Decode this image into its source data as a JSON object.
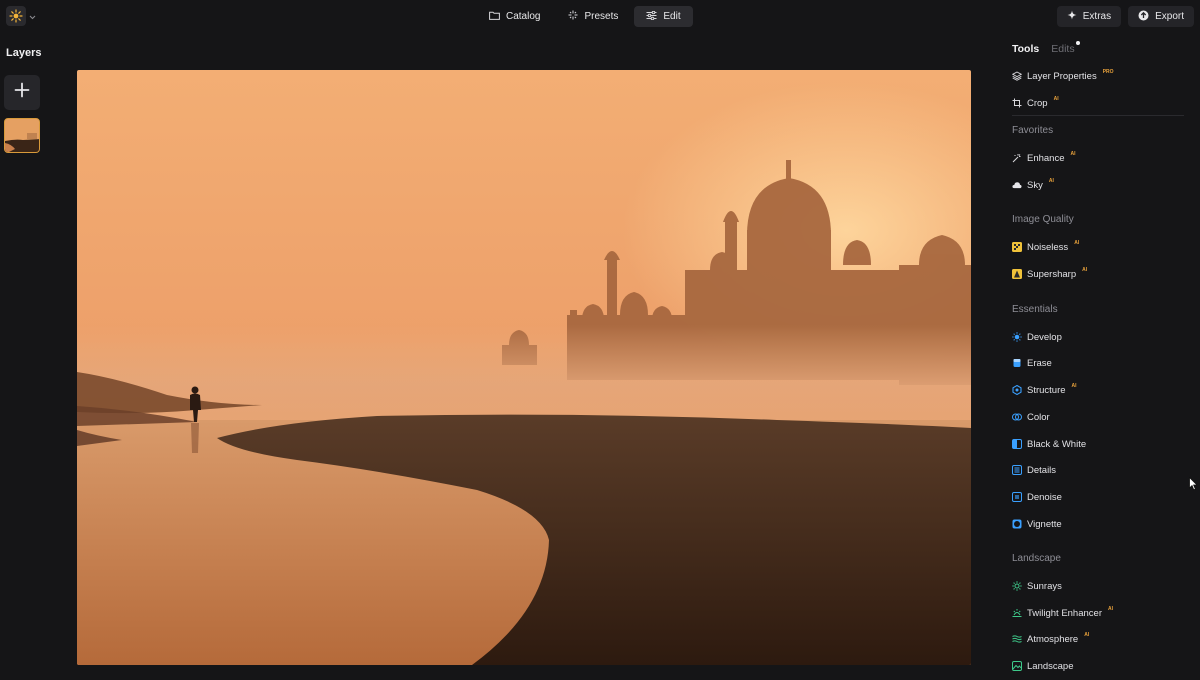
{
  "topbar": {
    "logo_icon": "sun-logo-icon",
    "tabs": [
      {
        "label": "Catalog",
        "icon": "folder-icon"
      },
      {
        "label": "Presets",
        "icon": "sparkle-icon"
      },
      {
        "label": "Edit",
        "icon": "sliders-icon",
        "active": true
      }
    ],
    "extras_label": "Extras",
    "export_label": "Export"
  },
  "layers": {
    "title": "Layers",
    "add_icon": "plus-icon"
  },
  "panel": {
    "tab_tools": "Tools",
    "tab_edits": "Edits",
    "top_tools": [
      {
        "label": "Layer Properties",
        "tag": "PRO",
        "icon": "layers-icon"
      },
      {
        "label": "Crop",
        "tag": "AI",
        "icon": "crop-icon"
      }
    ],
    "sections": [
      {
        "title": "Favorites",
        "tools": [
          {
            "label": "Enhance",
            "tag": "AI",
            "icon": "enhance-icon"
          },
          {
            "label": "Sky",
            "tag": "AI",
            "icon": "cloud-icon"
          }
        ]
      },
      {
        "title": "Image Quality",
        "tools": [
          {
            "label": "Noiseless",
            "tag": "AI",
            "icon": "noiseless-icon"
          },
          {
            "label": "Supersharp",
            "tag": "AI",
            "icon": "supersharp-icon"
          }
        ]
      },
      {
        "title": "Essentials",
        "tools": [
          {
            "label": "Develop",
            "tag": "",
            "icon": "develop-icon"
          },
          {
            "label": "Erase",
            "tag": "",
            "icon": "erase-icon"
          },
          {
            "label": "Structure",
            "tag": "AI",
            "icon": "structure-icon"
          },
          {
            "label": "Color",
            "tag": "",
            "icon": "color-icon"
          },
          {
            "label": "Black & White",
            "tag": "",
            "icon": "black-white-icon"
          },
          {
            "label": "Details",
            "tag": "",
            "icon": "details-icon"
          },
          {
            "label": "Denoise",
            "tag": "",
            "icon": "denoise-icon"
          },
          {
            "label": "Vignette",
            "tag": "",
            "icon": "vignette-icon"
          }
        ]
      },
      {
        "title": "Landscape",
        "tools": [
          {
            "label": "Sunrays",
            "tag": "",
            "icon": "sunrays-icon"
          },
          {
            "label": "Twilight Enhancer",
            "tag": "AI",
            "icon": "twilight-icon"
          },
          {
            "label": "Atmosphere",
            "tag": "AI",
            "icon": "atmosphere-icon"
          },
          {
            "label": "Landscape",
            "tag": "",
            "icon": "landscape-icon"
          }
        ]
      }
    ]
  },
  "colors": {
    "background": "#151517",
    "accent_orange": "#e9a23b",
    "tool_blue": "#3aa0ff",
    "tool_green": "#3ec98a",
    "tool_yellow": "#f0c23a"
  }
}
